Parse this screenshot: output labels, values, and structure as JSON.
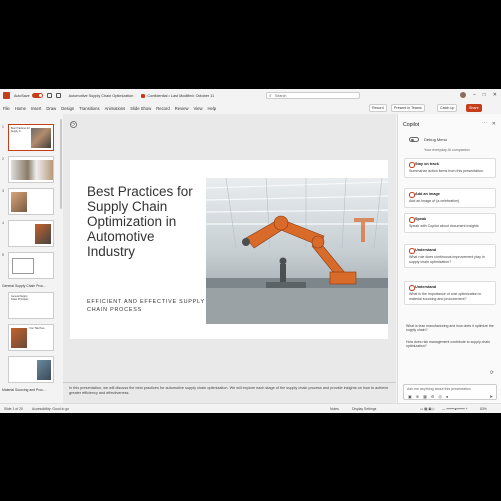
{
  "titlebar": {
    "autosave_label": "AutoSave",
    "toggle_state": "On",
    "doc_title": "Automotive Supply Chain Optimization",
    "sensitivity": "Confidential • Last Modified: October 11",
    "search_placeholder": "Search"
  },
  "ribbon": {
    "tabs": [
      "File",
      "Home",
      "Insert",
      "Draw",
      "Design",
      "Transitions",
      "Animations",
      "Slide Show",
      "Record",
      "Review",
      "View",
      "Help"
    ],
    "record_btn": "Record",
    "present_btn": "Present in Teams",
    "catchup_btn": "Catch up",
    "share_btn": "Share"
  },
  "thumbnails": [
    {
      "num": "1",
      "title": "Best Practices for Supply C..."
    },
    {
      "num": "2",
      "title": ""
    },
    {
      "num": "3",
      "title": ""
    },
    {
      "num": "4",
      "title": ""
    },
    {
      "num": "5",
      "title": ""
    }
  ],
  "sections": {
    "general": "General Supply Chain Proc...",
    "material": "Material Sourcing and Proc..."
  },
  "thumbnail_titles": {
    "s6": "General Supply Chain Principles",
    "s7": "Your Title Here"
  },
  "slide": {
    "title": "Best Practices for Supply Chain Optimization in Automotive Industry",
    "subtitle": "EFFICIENT AND EFFECTIVE SUPPLY CHAIN PROCESS"
  },
  "notes": "In this presentation, we will discuss the best practices for automotive supply chain optimization. We will explore each stage of the supply chain process and provide insights on how to achieve greater efficiency and effectiveness.",
  "status": {
    "slide_count": "Slide 1 of 20",
    "accessibility": "Accessibility: Good to go",
    "notes": "Notes",
    "display": "Display Settings",
    "zoom": "83%"
  },
  "copilot": {
    "title": "Copilot",
    "debug_label": "Debug Menu",
    "tagline": "Your everyday AI companion",
    "cards": [
      {
        "heading": "Stay on track",
        "body": "Summarize action items from this presentation."
      },
      {
        "heading": "Add an image",
        "body": "Add an image of (a celebration)"
      },
      {
        "heading": "Speak",
        "body": "Speak with Copilot about document insights"
      },
      {
        "heading": "Understand",
        "body": "What role does continuous improvement play in supply chain optimization?"
      },
      {
        "heading": "Understand",
        "body": "What is the importance of cost optimization in material sourcing and procurement?"
      }
    ],
    "suggestions": [
      "What is lean manufacturing and how does it optimize the supply chain?",
      "How does risk management contribute to supply chain optimization?"
    ],
    "input_placeholder": "Ask me anything about this presentation"
  },
  "colors": {
    "accent": "#c43e1c",
    "robot": "#d86a2a"
  }
}
